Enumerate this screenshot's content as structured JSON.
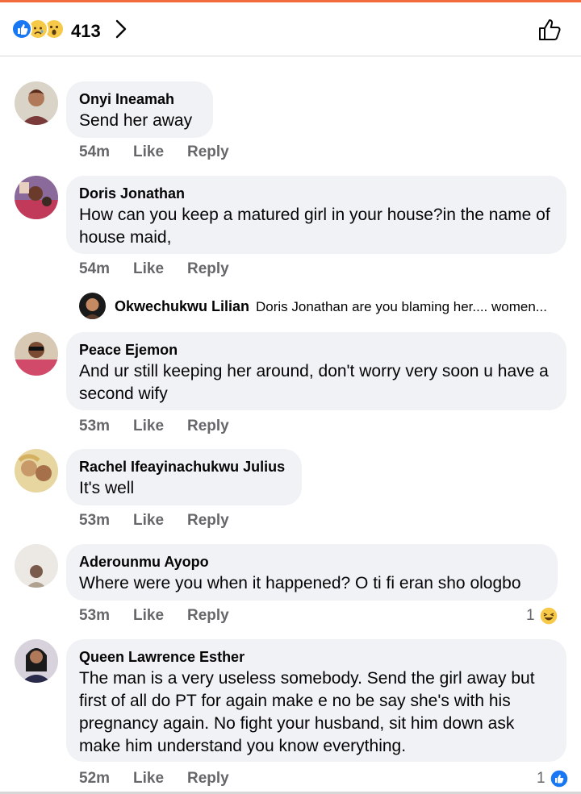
{
  "header": {
    "reaction_icons": [
      "like-reaction-icon",
      "sad-reaction-icon",
      "wow-reaction-icon"
    ],
    "reaction_count": "413",
    "accent_color": "#f26b3a",
    "like_color": "#1877f2"
  },
  "action_labels": {
    "like": "Like",
    "reply": "Reply"
  },
  "comments": [
    {
      "author": "Onyi Ineamah",
      "text": "Send her away",
      "time": "54m"
    },
    {
      "author": "Doris Jonathan",
      "text": "How can you keep a matured girl in your house?in the name of house maid,",
      "time": "54m",
      "reply_preview": {
        "author": "Okwechukwu Lilian",
        "text": "Doris Jonathan are you blaming her.... women..."
      }
    },
    {
      "author": "Peace Ejemon",
      "text": "And ur still keeping her around, don't worry very soon u have a second wify",
      "time": "53m"
    },
    {
      "author": "Rachel Ifeayinachukwu Julius",
      "text": "It's well",
      "time": "53m"
    },
    {
      "author": "Aderounmu Ayopo",
      "text": "Where were you when it happened? O ti fi eran sho ologbo",
      "time": "53m",
      "reaction_count": "1",
      "reaction_icon": "haha-reaction-icon"
    },
    {
      "author": "Queen Lawrence Esther",
      "text": "The man is a very useless somebody. Send the girl away but first of all do PT for again make e no be say she's with his pregnancy again. No fight your husband, sit him down ask make him understand you know everything.",
      "time": "52m",
      "reaction_count": "1",
      "reaction_icon": "like-reaction-icon"
    }
  ]
}
